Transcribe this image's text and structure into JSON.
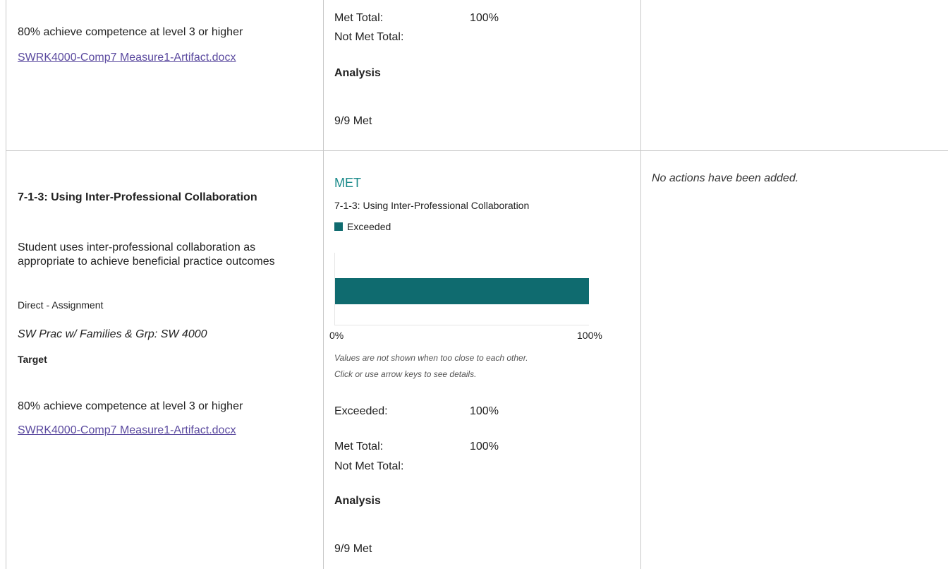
{
  "colors": {
    "met_status": "#1a8a8a",
    "exceeded_bar": "#0f6b6f",
    "link": "#5b4a9f"
  },
  "top_row": {
    "target_text": "80% achieve competence at level 3 or higher",
    "artifact_link": "SWRK4000-Comp7 Measure1-Artifact.docx",
    "met_total_label": "Met Total:",
    "met_total_value": "100%",
    "not_met_total_label": "Not Met Total:",
    "not_met_total_value": "",
    "analysis_label": "Analysis",
    "analysis_value": "9/9 Met"
  },
  "row": {
    "outcome_title": "7-1-3: Using Inter-Professional Collaboration",
    "outcome_description": "Student uses inter-professional collaboration as appropriate to achieve beneficial practice outcomes",
    "measure_type": "Direct - Assignment",
    "course": "SW Prac w/ Families & Grp: SW 4000",
    "target_label": "Target",
    "target_text": "80% achieve competence at level 3 or higher",
    "artifact_link": "SWRK4000-Comp7 Measure1-Artifact.docx",
    "status": "MET",
    "results_title": "7-1-3: Using Inter-Professional Collaboration",
    "legend_label": "Exceeded",
    "axis_min_label": "0%",
    "axis_max_label": "100%",
    "chart_note_1": "Values are not shown when too close to each other.",
    "chart_note_2": "Click or use arrow keys to see details.",
    "exceeded_label": "Exceeded:",
    "exceeded_value": "100%",
    "met_total_label": "Met Total:",
    "met_total_value": "100%",
    "not_met_total_label": "Not Met Total:",
    "not_met_total_value": "",
    "analysis_label": "Analysis",
    "analysis_value": "9/9 Met",
    "actions_text": "No actions have been added."
  },
  "chart_data": {
    "type": "bar",
    "orientation": "horizontal",
    "title": "",
    "categories": [
      "7-1-3: Using Inter-Professional Collaboration"
    ],
    "series": [
      {
        "name": "Exceeded",
        "values": [
          100
        ]
      }
    ],
    "xlim": [
      0,
      100
    ],
    "xtick_labels": [
      "0%",
      "100%"
    ],
    "grid": false,
    "legend": "top-left"
  }
}
